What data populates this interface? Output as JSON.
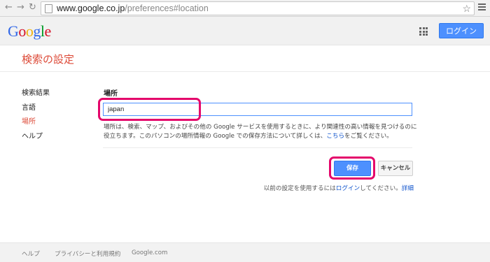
{
  "browser": {
    "address_host": "www.google.co.jp",
    "address_path": "/preferences#location"
  },
  "header": {
    "logo_letters": [
      {
        "ch": "G",
        "color": "#3369e8"
      },
      {
        "ch": "o",
        "color": "#d50f25"
      },
      {
        "ch": "o",
        "color": "#eeb211"
      },
      {
        "ch": "g",
        "color": "#3369e8"
      },
      {
        "ch": "l",
        "color": "#009925"
      },
      {
        "ch": "e",
        "color": "#d50f25"
      }
    ],
    "login_label": "ログイン"
  },
  "page": {
    "title": "検索の設定"
  },
  "sidebar": {
    "items": [
      {
        "label": "検索結果"
      },
      {
        "label": "言語"
      },
      {
        "label": "場所"
      },
      {
        "label": "ヘルプ"
      }
    ]
  },
  "location": {
    "heading": "場所",
    "value": "japan",
    "description_1": "場所は、検索、マップ、およびその他の Google サービスを使用するときに、より関連性の高い情報を見つけるのに",
    "description_2": "役立ちます。このパソコンの場所情報の Google での保存方法について詳しくは、",
    "description_link": "こちら",
    "description_3": "をご覧ください。"
  },
  "actions": {
    "save_label": "保存",
    "cancel_label": "キャンセル",
    "restore_prefix": "以前の設定を使用するには",
    "restore_link": "ログイン",
    "restore_suffix": "してください。",
    "details_link": "詳細"
  },
  "footer": {
    "help": "ヘルプ",
    "privacy": "プライバシーと利用規約",
    "google_com": "Google.com"
  }
}
